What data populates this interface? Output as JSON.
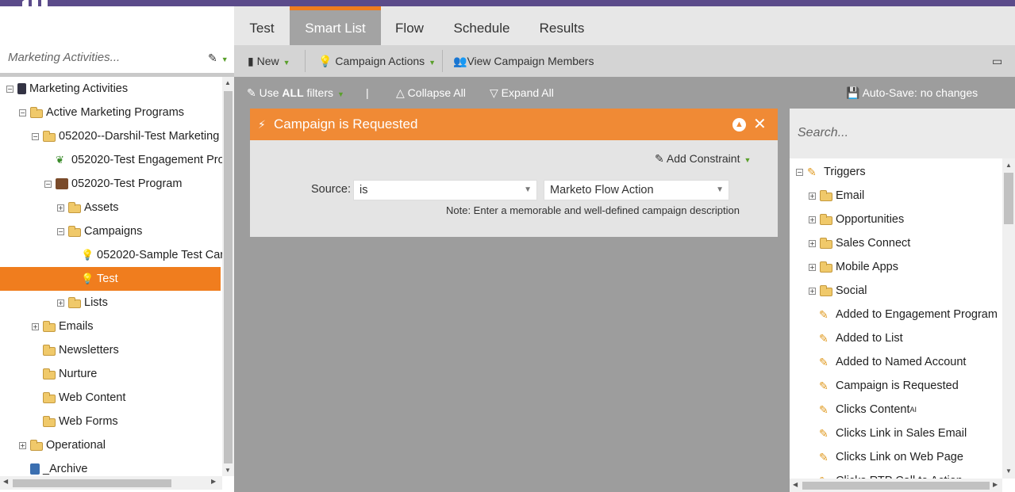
{
  "left_panel": {
    "search_placeholder": "Marketing Activities...",
    "tree": [
      {
        "label": "Marketing Activities",
        "expander": "⊟",
        "icon": "database-icon"
      },
      {
        "label": "Active Marketing Programs",
        "expander": "⊟",
        "icon": "folder-icon"
      },
      {
        "label": "052020--Darshil-Test Marketing",
        "expander": "⊟",
        "icon": "folder-icon"
      },
      {
        "label": "052020-Test Engagement Pro",
        "expander": "",
        "icon": "engagement-program-icon"
      },
      {
        "label": "052020-Test Program",
        "expander": "⊟",
        "icon": "program-icon"
      },
      {
        "label": "Assets",
        "expander": "⊞",
        "icon": "folder-icon"
      },
      {
        "label": "Campaigns",
        "expander": "⊟",
        "icon": "folder-icon"
      },
      {
        "label": "052020-Sample Test Car",
        "expander": "",
        "icon": "smart-campaign-icon"
      },
      {
        "label": "Test",
        "expander": "",
        "icon": "smart-campaign-icon",
        "selected": true
      },
      {
        "label": "Lists",
        "expander": "⊞",
        "icon": "folder-icon"
      },
      {
        "label": "Emails",
        "expander": "⊞",
        "icon": "folder-icon"
      },
      {
        "label": "Newsletters",
        "expander": "",
        "icon": "folder-icon"
      },
      {
        "label": "Nurture",
        "expander": "",
        "icon": "folder-icon"
      },
      {
        "label": "Web Content",
        "expander": "",
        "icon": "folder-icon"
      },
      {
        "label": "Web Forms",
        "expander": "",
        "icon": "folder-icon"
      },
      {
        "label": "Operational",
        "expander": "⊞",
        "icon": "folder-icon"
      },
      {
        "label": "_Archive",
        "expander": "",
        "icon": "archive-icon"
      }
    ]
  },
  "tabs": [
    {
      "label": "Test"
    },
    {
      "label": "Smart List",
      "active": true
    },
    {
      "label": "Flow"
    },
    {
      "label": "Schedule"
    },
    {
      "label": "Results"
    }
  ],
  "toolbar": {
    "new_label": "New",
    "campaign_actions_label": "Campaign Actions",
    "view_members_label": "View Campaign Members"
  },
  "filter_toolbar": {
    "use_prefix": "Use",
    "use_bold": "ALL",
    "use_suffix": "filters",
    "divider": "|",
    "collapse_all": "Collapse All",
    "expand_all": "Expand All",
    "autosave": "Auto-Save: no changes"
  },
  "filter": {
    "title": "Campaign is Requested",
    "add_constraint": "Add Constraint",
    "source_label": "Source:",
    "operator_value": "is",
    "source_value": "Marketo Flow Action",
    "note": "Note: Enter a memorable and well-defined campaign description"
  },
  "right_panel": {
    "search_placeholder": "Search...",
    "tree": [
      {
        "label": "Triggers",
        "type": "root"
      },
      {
        "label": "Email",
        "type": "folder"
      },
      {
        "label": "Opportunities",
        "type": "folder"
      },
      {
        "label": "Sales Connect",
        "type": "folder"
      },
      {
        "label": "Mobile Apps",
        "type": "folder"
      },
      {
        "label": "Social",
        "type": "folder"
      },
      {
        "label": "Added to Engagement Program",
        "type": "trigger"
      },
      {
        "label": "Added to List",
        "type": "trigger"
      },
      {
        "label": "Added to Named Account",
        "type": "trigger"
      },
      {
        "label": "Campaign is Requested",
        "type": "trigger"
      },
      {
        "label": "Clicks Content",
        "type": "trigger",
        "sup": "AI"
      },
      {
        "label": "Clicks Link in Sales Email",
        "type": "trigger"
      },
      {
        "label": "Clicks Link on Web Page",
        "type": "trigger"
      },
      {
        "label": "Clicks RTP Call to Action",
        "type": "trigger"
      }
    ]
  },
  "colors": {
    "brand_purple": "#5b4b8a",
    "accent_orange": "#f07d1e",
    "filter_header": "#f08a35"
  }
}
